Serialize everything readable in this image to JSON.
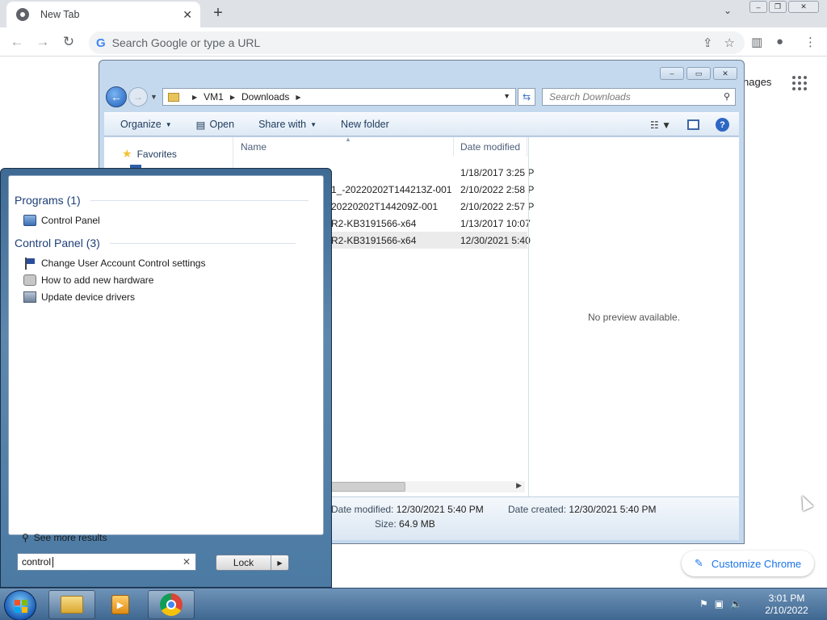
{
  "chrome": {
    "tab_title": "New Tab",
    "tab_close": "✕",
    "new_tab": "+",
    "omnibox_placeholder": "Search Google or type a URL",
    "ntp_images_partial": "nages",
    "customize_label": "Customize Chrome"
  },
  "explorer": {
    "breadcrumb": [
      "VM1",
      "Downloads"
    ],
    "search_placeholder": "Search Downloads",
    "commands": {
      "organize": "Organize",
      "open": "Open",
      "share_with": "Share with",
      "new_folder": "New folder"
    },
    "nav": {
      "favorites": "Favorites"
    },
    "columns": {
      "name": "Name",
      "date_modified": "Date modified"
    },
    "files": [
      {
        "name": "",
        "date": "1/18/2017 3:25 P",
        "selected": false
      },
      {
        "name": "1_-20220202T144213Z-001",
        "date": "2/10/2022 2:58 P",
        "selected": false
      },
      {
        "name": "20220202T144209Z-001",
        "date": "2/10/2022 2:57 P",
        "selected": false
      },
      {
        "name": "R2-KB3191566-x64",
        "date": "1/13/2017 10:07",
        "selected": false
      },
      {
        "name": "R2-KB3191566-x64",
        "date": "12/30/2021 5:40",
        "selected": true
      }
    ],
    "preview_text": "No preview available.",
    "details": {
      "date_modified_label": "Date modified:",
      "date_modified_value": "12/30/2021 5:40 PM",
      "date_created_label": "Date created:",
      "date_created_value": "12/30/2021 5:40 PM",
      "size_label": "Size:",
      "size_value": "64.9 MB"
    }
  },
  "start_menu": {
    "programs_header": "Programs (1)",
    "programs": [
      "Control Panel"
    ],
    "control_panel_header": "Control Panel (3)",
    "control_panel_items": [
      "Change User Account Control settings",
      "How to add new hardware",
      "Update device drivers"
    ],
    "see_more": "See more results",
    "search_value": "control",
    "lock_label": "Lock"
  },
  "taskbar": {
    "time": "3:01 PM",
    "date": "2/10/2022"
  }
}
